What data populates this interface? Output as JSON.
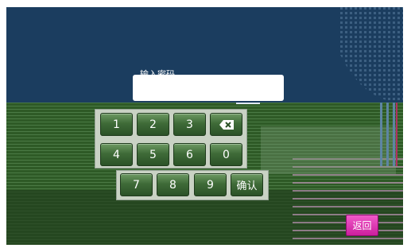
{
  "password": {
    "label": "输入密码",
    "value": ""
  },
  "keypad": {
    "keys": {
      "k1": "1",
      "k2": "2",
      "k3": "3",
      "k4": "4",
      "k5": "5",
      "k6": "6",
      "k0": "0",
      "k7": "7",
      "k8": "8",
      "k9": "9",
      "confirm": "确认"
    },
    "backspace_icon": "backspace-icon"
  },
  "back_button": {
    "label": "返回"
  },
  "colors": {
    "background": "#1b3d5f",
    "key_green": "#3f6b38",
    "back_button": "#e03ab5"
  }
}
